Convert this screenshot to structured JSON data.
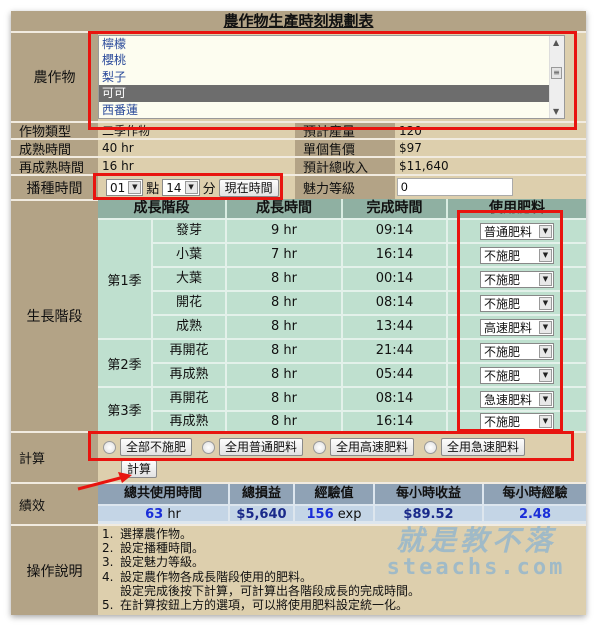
{
  "title": "農作物生產時刻規劃表",
  "crop": {
    "label": "農作物",
    "options": [
      "檸檬",
      "櫻桃",
      "梨子",
      "可可",
      "西番蓮"
    ],
    "selected": "可可"
  },
  "info": {
    "type_label": "作物類型",
    "type_value": "二季作物",
    "mature_label": "成熟時間",
    "mature_value": "40 hr",
    "remature_label": "再成熟時間",
    "remature_value": "16 hr",
    "yield_label": "預計產量",
    "yield_value": "120",
    "price_label": "單個售價",
    "price_value": "$97",
    "income_label": "預計總收入",
    "income_value": "$11,640"
  },
  "sowing": {
    "label": "播種時間",
    "hour": "01",
    "hour_unit": "點",
    "minute": "14",
    "minute_unit": "分",
    "now_button": "現在時間"
  },
  "charm": {
    "label": "魅力等級",
    "value": "0"
  },
  "growth": {
    "label": "生長階段",
    "headers": [
      "成長階段",
      "成長時間",
      "完成時間",
      "使用肥料"
    ],
    "seasons": [
      "第1季",
      "第2季",
      "第3季"
    ],
    "rows": [
      {
        "stage": "發芽",
        "hours": "9 hr",
        "done": "09:14",
        "fertilizer": "普通肥料"
      },
      {
        "stage": "小葉",
        "hours": "7 hr",
        "done": "16:14",
        "fertilizer": "不施肥"
      },
      {
        "stage": "大葉",
        "hours": "8 hr",
        "done": "00:14",
        "fertilizer": "不施肥"
      },
      {
        "stage": "開花",
        "hours": "8 hr",
        "done": "08:14",
        "fertilizer": "不施肥"
      },
      {
        "stage": "成熟",
        "hours": "8 hr",
        "done": "13:44",
        "fertilizer": "高速肥料"
      },
      {
        "stage": "再開花",
        "hours": "8 hr",
        "done": "21:44",
        "fertilizer": "不施肥"
      },
      {
        "stage": "再成熟",
        "hours": "8 hr",
        "done": "05:44",
        "fertilizer": "不施肥"
      },
      {
        "stage": "再開花",
        "hours": "8 hr",
        "done": "08:14",
        "fertilizer": "急速肥料"
      },
      {
        "stage": "再成熟",
        "hours": "8 hr",
        "done": "16:14",
        "fertilizer": "不施肥"
      }
    ]
  },
  "calc": {
    "label": "計算",
    "options": [
      "全部不施肥",
      "全用普通肥料",
      "全用高速肥料",
      "全用急速肥料"
    ],
    "button": "計算"
  },
  "performance": {
    "label": "績效",
    "headers": [
      "總共使用時間",
      "總損益",
      "經驗值",
      "每小時收益",
      "每小時經驗"
    ],
    "total_time": "63",
    "total_time_unit": " hr",
    "profit": "$5,640",
    "exp": "156",
    "exp_unit": " exp",
    "profit_per_hour": "$89.52",
    "exp_per_hour": "2.48"
  },
  "instructions": {
    "label": "操作說明",
    "items": [
      {
        "num": "1.",
        "text": "選擇農作物。"
      },
      {
        "num": "2.",
        "text": "設定播種時間。"
      },
      {
        "num": "3.",
        "text": "設定魅力等級。"
      },
      {
        "num": "4.",
        "text": "設定農作物各成長階段使用的肥料。"
      },
      {
        "num": "",
        "text": "設定完成後按下計算，可計算出各階段成長的完成時間。"
      },
      {
        "num": "5.",
        "text": "在計算按鈕上方的選項，可以將使用肥料設定統一化。"
      }
    ]
  },
  "watermark": {
    "line1": "就是教不落",
    "line2": "steachs.com"
  }
}
